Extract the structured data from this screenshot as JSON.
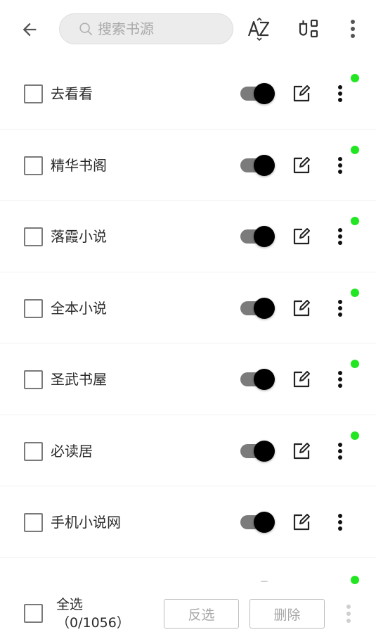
{
  "header": {
    "search_placeholder": "搜索书源",
    "icons": {
      "back": "arrow-left-icon",
      "search": "search-icon",
      "sort": "sort-az-icon",
      "group": "group-icon",
      "more": "more-vertical-icon"
    }
  },
  "sources": [
    {
      "name": "去看看",
      "enabled": true,
      "checked": false,
      "status": true
    },
    {
      "name": "精华书阁",
      "enabled": true,
      "checked": false,
      "status": true
    },
    {
      "name": "落霞小说",
      "enabled": true,
      "checked": false,
      "status": true
    },
    {
      "name": "全本小说",
      "enabled": true,
      "checked": false,
      "status": true
    },
    {
      "name": "圣武书屋",
      "enabled": true,
      "checked": false,
      "status": true
    },
    {
      "name": " 必读居",
      "enabled": true,
      "checked": false,
      "status": true
    },
    {
      "name": "手机小说网",
      "enabled": true,
      "checked": false,
      "status": false
    }
  ],
  "footer": {
    "select_all_label": "全选",
    "selection_count": "（0/1056）",
    "invert_label": "反选",
    "delete_label": "删除"
  },
  "colors": {
    "status_dot": "#22e622",
    "switch_thumb": "#000000",
    "switch_track": "#7b7b7b",
    "search_bg": "#ececec"
  }
}
